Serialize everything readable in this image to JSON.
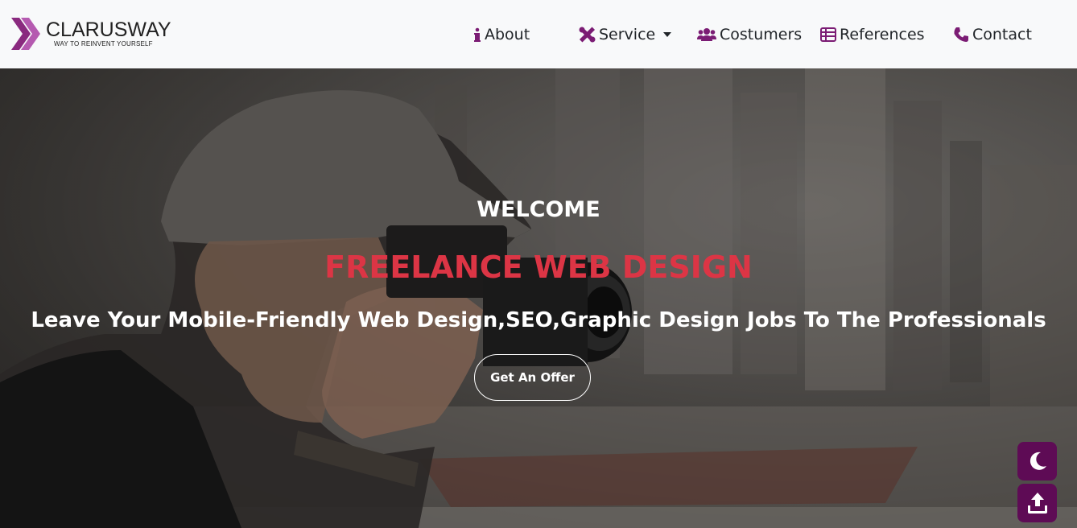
{
  "brand": {
    "name": "CLARUSWAY",
    "tagline": "WAY TO REINVENT YOURSELF"
  },
  "nav": {
    "about": {
      "label": "About",
      "icon": "info-icon"
    },
    "service": {
      "label": "Service",
      "icon": "tools-icon"
    },
    "costumers": {
      "label": "Costumers",
      "icon": "users-icon"
    },
    "references": {
      "label": "References",
      "icon": "table-icon"
    },
    "contact": {
      "label": "Contact",
      "icon": "phone-icon"
    }
  },
  "hero": {
    "welcome": "WELCOME",
    "headline": "FREELANCE WEB DESIGN",
    "subline": "Leave Your Mobile-Friendly Web Design,SEO,Graphic Design Jobs To The Professionals",
    "cta": "Get An Offer"
  },
  "floating": {
    "theme_icon": "moon-icon",
    "scroll_icon": "upload-icon"
  },
  "colors": {
    "accent": "#7b1c74",
    "headline": "#dc3545",
    "floating_bg": "#5e0b55",
    "navbar_bg": "#f8f9fa"
  }
}
